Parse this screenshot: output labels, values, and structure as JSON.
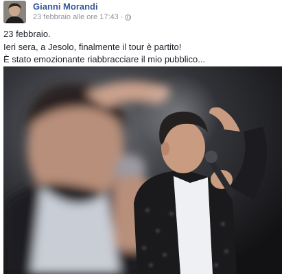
{
  "post": {
    "author": "Gianni Morandi",
    "timestamp": "23 febbraio alle ore 17:43",
    "separator": "·",
    "privacy_icon": "globe-icon",
    "text_lines": [
      "23 febbraio.",
      "Ieri sera, a Jesolo, finalmente il tour è partito!",
      "È stato emozionante riabbracciare il mio pubblico..."
    ],
    "photo_icon": "concert-photo"
  },
  "colors": {
    "author_link": "#365899",
    "meta_text": "#90949c",
    "body_text": "#1d2129"
  }
}
